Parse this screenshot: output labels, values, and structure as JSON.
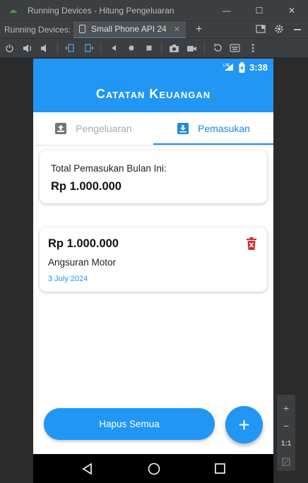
{
  "window": {
    "title": "Running Devices - Hitung Pengeluaran",
    "minimize_label": "—",
    "maximize_label": "☐",
    "close_label": "✕"
  },
  "tabbar": {
    "label": "Running Devices:",
    "device_tab": "Small Phone API 24",
    "close_label": "✕",
    "add_label": "+"
  },
  "status": {
    "time": "3:38",
    "network": "LTE"
  },
  "app": {
    "title": "Catatan Keuangan",
    "tabs": [
      {
        "label": "Pengeluaran",
        "active": false
      },
      {
        "label": "Pemasukan",
        "active": true
      }
    ],
    "total": {
      "label": "Total Pemasukan Bulan Ini:",
      "value": "Rp 1.000.000"
    },
    "items": [
      {
        "amount": "Rp 1.000.000",
        "description": "Angsuran Motor",
        "date": "3 July 2024"
      }
    ],
    "clear_all_label": "Hapus Semua",
    "fab_label": "+"
  },
  "sidepanel": {
    "zoom_in": "+",
    "zoom_out": "−",
    "ratio": "1:1"
  },
  "colors": {
    "primary": "#2196f3",
    "delete": "#d32f2f",
    "ide_bg": "#3c3f41"
  }
}
